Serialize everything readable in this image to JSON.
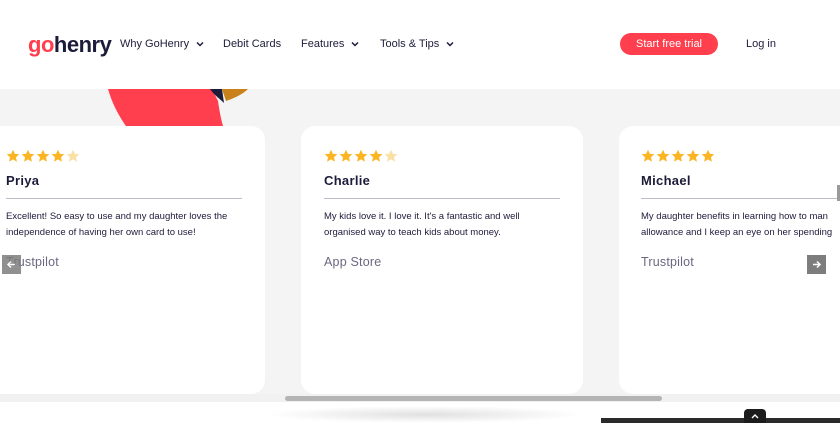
{
  "header": {
    "logo_go": "go",
    "logo_henry": "henry",
    "nav": [
      {
        "label": "Why GoHenry",
        "has_dropdown": true
      },
      {
        "label": "Debit Cards",
        "has_dropdown": false
      },
      {
        "label": "Features",
        "has_dropdown": true
      },
      {
        "label": "Tools & Tips",
        "has_dropdown": true
      }
    ],
    "cta_label": "Start free trial",
    "login_label": "Log in"
  },
  "reviews": [
    {
      "name": "Priya",
      "rating": 4,
      "text_line1": "Excellent! So easy to use and my daughter loves the",
      "text_line2": "independence of having her own card to use!",
      "source": "Trustpilot"
    },
    {
      "name": "Charlie",
      "rating": 4,
      "text_line1": "My kids love it. I love it. It's a fantastic and well",
      "text_line2": "organised way to teach kids about money.",
      "source": "App Store"
    },
    {
      "name": "Michael",
      "rating": 5,
      "text_line1": "My daughter benefits in learning how to man",
      "text_line2": "allowance and I keep an eye on her spending",
      "source": "Trustpilot"
    }
  ],
  "carousel": {
    "prev_icon": "arrow-left-icon",
    "next_icon": "arrow-right-icon"
  },
  "colors": {
    "brand_red": "#ff3f4e",
    "navy": "#1d1b3a",
    "star_gold": "#fbb522",
    "star_empty": "#f9e0a6"
  }
}
